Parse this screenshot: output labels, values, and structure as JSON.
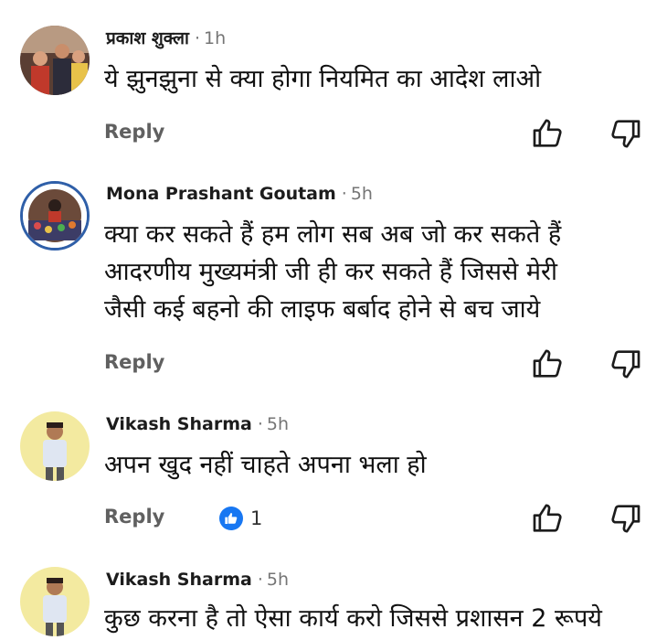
{
  "comments": [
    {
      "author": "प्रकाश शुक्ला",
      "separator": "·",
      "time": "1h",
      "lines": [
        "ये झुनझुना से क्या होगा नियमित का आदेश लाओ"
      ],
      "reply_label": "Reply",
      "like_icon": "thumb-up-icon",
      "dislike_icon": "thumb-down-icon"
    },
    {
      "author": "Mona Prashant Goutam",
      "separator": "·",
      "time": "5h",
      "lines": [
        "क्या कर सकते हैं  हम लोग सब अब जो कर सकते हैं",
        "आदरणीय मुख्यमंत्री जी ही कर सकते हैं जिससे मेरी",
        "जैसी कई बहनो की लाइफ बर्बाद होने से बच जाये"
      ],
      "reply_label": "Reply",
      "like_icon": "thumb-up-icon",
      "dislike_icon": "thumb-down-icon"
    },
    {
      "author": "Vikash Sharma",
      "separator": "·",
      "time": "5h",
      "lines": [
        "अपन खुद नहीं चाहते अपना भला हो"
      ],
      "reply_label": "Reply",
      "reaction_count": "1",
      "reaction_color": "#1877f2",
      "like_icon": "thumb-up-icon",
      "dislike_icon": "thumb-down-icon"
    },
    {
      "author": "Vikash Sharma",
      "separator": "·",
      "time": "5h",
      "lines": [
        "कुछ करना है तो ऐसा कार्य करो जिससे प्रशासन 2 रूपये"
      ]
    }
  ]
}
